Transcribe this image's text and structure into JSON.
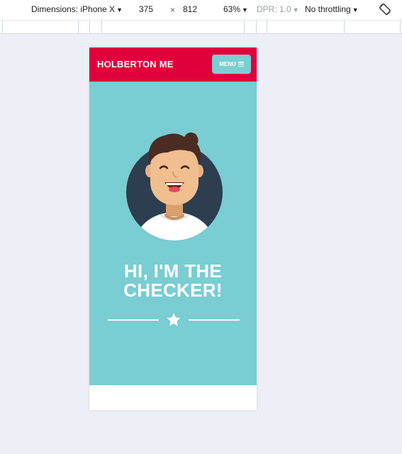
{
  "devtools": {
    "dimensions_label": "Dimensions: iPhone X",
    "width": "375",
    "times": "×",
    "height": "812",
    "zoom": "63%",
    "dpr": "DPR: 1.0",
    "throttling": "No throttling",
    "caret": "▼"
  },
  "site": {
    "brand": "HOLBERTON ME",
    "menu_label": "MENU",
    "hero_title_line1": "HI, I'M THE",
    "hero_title_line2": "CHECKER!"
  },
  "colors": {
    "header_red": "#e0003c",
    "hero_teal": "#79cdd3",
    "menu_button": "#7acfd3",
    "avatar_circle": "#2c3e50"
  },
  "icons": {
    "menu": "hamburger-icon",
    "divider": "star-icon",
    "rotate": "rotate-icon"
  }
}
